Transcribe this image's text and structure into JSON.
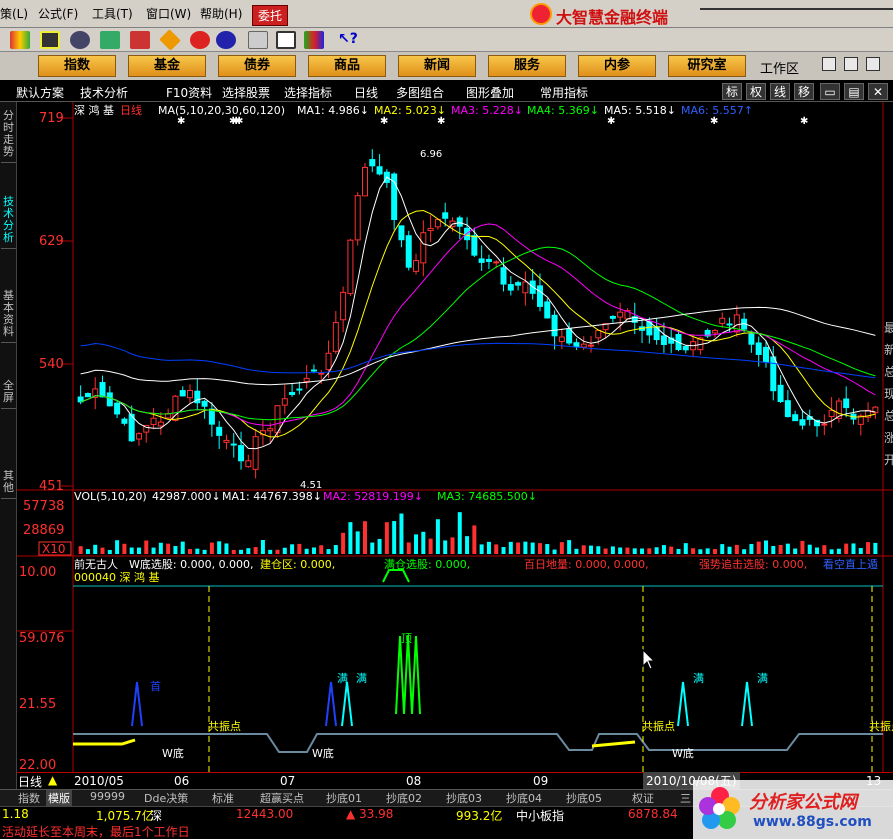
{
  "menu": {
    "items": [
      "策(L)",
      "公式(F)",
      "工具(T)",
      "窗口(W)",
      "帮助(H)"
    ],
    "entrust": "委托",
    "brand": "大智慧金融终端"
  },
  "navbar": {
    "buttons": [
      "指数",
      "基金",
      "债券",
      "商品",
      "新闻",
      "服务",
      "内参",
      "研究室"
    ],
    "workspace": "工作区"
  },
  "tabstrip": {
    "items": [
      "默认方案",
      "技术分析",
      "F10资料",
      "选择股票",
      "选择指标",
      "日线",
      "多图组合",
      "图形叠加",
      "常用指标"
    ],
    "right": [
      "标",
      "权",
      "线",
      "移"
    ]
  },
  "sidebar": {
    "tabs": [
      "分时走势",
      "技术分析",
      "基本资料",
      "全屏",
      "其他"
    ],
    "active": "技术分析"
  },
  "main_chart": {
    "title": "深 鸿 基",
    "period": "日线",
    "ma_params": "MA(5,10,20,30,60,120)",
    "ma1": "MA1: 4.986↓",
    "ma2": "MA2: 5.023↓",
    "ma3": "MA3: 5.228↓",
    "ma4": "MA4: 5.369↓",
    "ma5": "MA5: 5.518↓",
    "ma6": "MA6: 5.557↑",
    "y_ticks": [
      "719",
      "629",
      "540",
      "451"
    ],
    "high_label": "6.96",
    "low_label": "4.51",
    "right_edge_text": [
      "最",
      "新",
      "总",
      "现",
      "总",
      "涨",
      "开"
    ]
  },
  "volume_chart": {
    "header": "VOL(5,10,20)",
    "vol": "42987.000↓",
    "ma1": "MA1: 44767.398↓",
    "ma2": "MA2: 52819.199↓",
    "ma3": "MA3: 74685.500↓",
    "y_ticks": [
      "57738",
      "28869"
    ],
    "unit": "X10"
  },
  "indicator_chart": {
    "line1_name": "前无古人",
    "w_select": "W底选股: 0.000, 0.000,",
    "build_zone": "建仓区: 0.000,",
    "full_select": "满仓选股: 0.000,",
    "hundred_day": "百日地量: 0.000, 0.000,",
    "strong_chase": "强势追击选股: 0.000,",
    "sky_blue": "看空直上遁",
    "stock_line": "000040 深 鸿 基",
    "y_ticks": [
      "10.00",
      "59.076",
      "21.55",
      "22.00"
    ],
    "label_resonance": "共振点",
    "label_wbottom": "W底",
    "label_buy": "首",
    "label_full": "满",
    "label_top": "顶"
  },
  "datebar": {
    "period": "日线",
    "dates": [
      "2010/05",
      "06",
      "07",
      "08",
      "09"
    ],
    "cursor": "2010/10/08(五)",
    "end": "13"
  },
  "bottom_tabs": {
    "items": [
      "指数",
      "模版",
      "99999",
      "Dde决策",
      "标准",
      "超赢买点",
      "抄底01",
      "抄底02",
      "抄底03",
      "抄底04",
      "抄底05",
      "权证",
      "三"
    ],
    "active": "模版"
  },
  "status": {
    "v1": "1.18",
    "v2": "1,075.7亿",
    "mkt": "深",
    "v3": "12443.00",
    "v4": "▲ 33.98",
    "v5": "993.2亿",
    "board": "中小板指",
    "v6": "6878.84"
  },
  "ticker": "活动延长至本周末，最后1个工作日",
  "watermark": {
    "title": "分析家公式网",
    "url": "www.88gs.com"
  },
  "colors": {
    "ma1": "#ffffff",
    "ma2": "#ffff00",
    "ma3": "#ff00ff",
    "ma4": "#00ff00",
    "ma5": "#ffffff",
    "ma6": "#0040ff",
    "candle_up": "#ff3030",
    "candle_down": "#00ffff",
    "frame": "#b00000"
  }
}
